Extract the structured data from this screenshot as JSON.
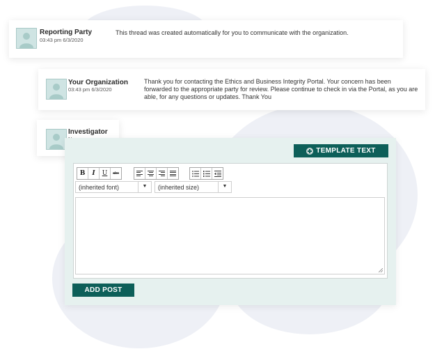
{
  "thread": [
    {
      "name": "Reporting Party",
      "time": "03:43 pm 6/3/2020",
      "message": "This thread was created automatically for you to communicate with the organization."
    },
    {
      "name": "Your Organization",
      "time": "03:43 pm 6/3/2020",
      "message": "Thank you for contacting the Ethics and Business Integrity Portal. Your concern has been forwarded to the appropriate party for review. Please continue to check in via the Portal, as you are able, for any questions or updates. Thank You"
    },
    {
      "name": "Investigator",
      "time": "Now"
    }
  ],
  "editor": {
    "template_button": "TEMPLATE TEXT",
    "font_select": "(inherited font)",
    "size_select": "(inherited size)",
    "format_buttons": {
      "bold": "B",
      "italic": "I",
      "underline": "U",
      "strike": "abc"
    },
    "submit_button": "ADD POST"
  },
  "colors": {
    "accent": "#0d5f59",
    "panel_bg": "#e6f1ef",
    "avatar_bg": "#cfe4e3"
  },
  "icons": [
    "user-avatar-icon",
    "plus-circle-icon",
    "align-left-icon",
    "align-center-icon",
    "align-right-icon",
    "align-justify-icon",
    "bullet-list-icon",
    "numbered-list-icon",
    "outdent-icon",
    "dropdown-arrow-icon",
    "resize-grip-icon"
  ]
}
